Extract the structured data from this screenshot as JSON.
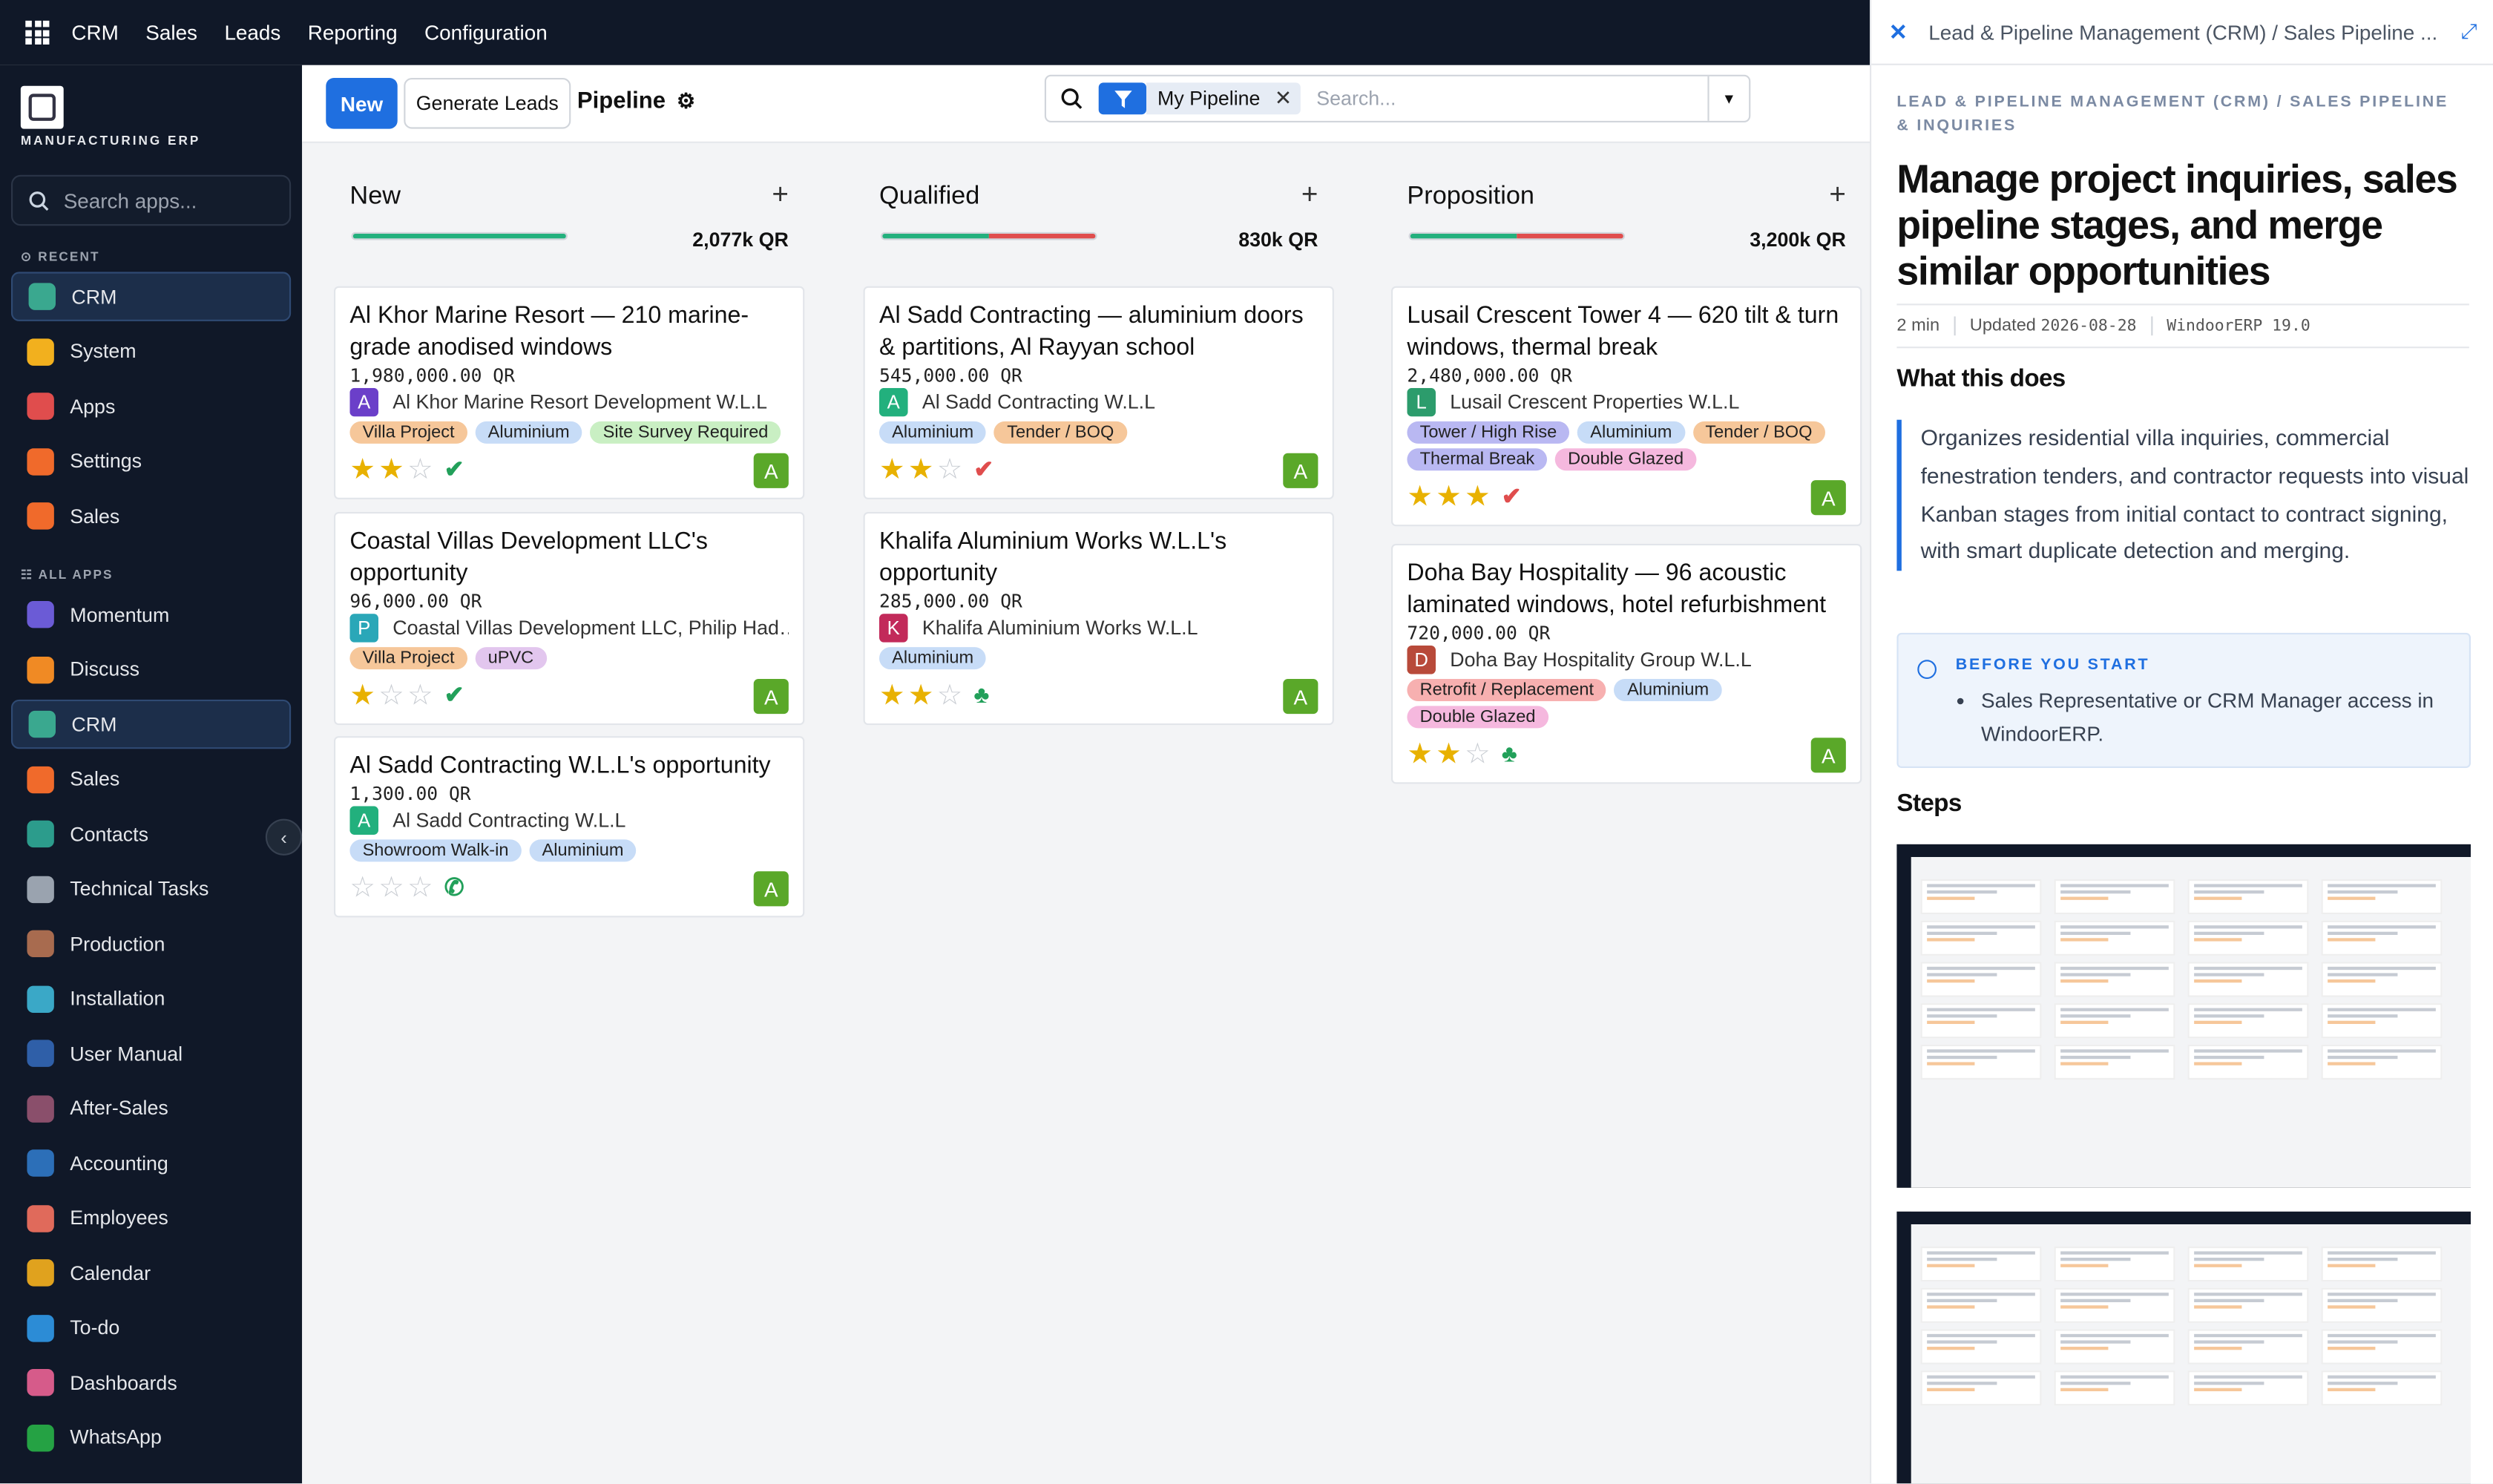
{
  "topbar": {
    "menus": [
      "CRM",
      "Sales",
      "Leads",
      "Reporting",
      "Configuration"
    ]
  },
  "sidebar": {
    "logo_text": "MANUFACTURING ERP",
    "search_placeholder": "Search apps...",
    "recent_label": "RECENT",
    "all_apps_label": "ALL APPS",
    "recent": [
      {
        "label": "CRM",
        "color": "#3aa88f"
      },
      {
        "label": "System",
        "color": "#f2b01e"
      },
      {
        "label": "Apps",
        "color": "#e04d4d"
      },
      {
        "label": "Settings",
        "color": "#f06a2b"
      },
      {
        "label": "Sales",
        "color": "#f06a2b"
      }
    ],
    "apps": [
      {
        "label": "Momentum",
        "color": "#6b5bd6"
      },
      {
        "label": "Discuss",
        "color": "#f08a24"
      },
      {
        "label": "CRM",
        "color": "#3aa88f"
      },
      {
        "label": "Sales",
        "color": "#f06a2b"
      },
      {
        "label": "Contacts",
        "color": "#2c9c8c"
      },
      {
        "label": "Technical Tasks",
        "color": "#9aa3af"
      },
      {
        "label": "Production",
        "color": "#a86b4f"
      },
      {
        "label": "Installation",
        "color": "#3aa8c7"
      },
      {
        "label": "User Manual",
        "color": "#2f5fa8"
      },
      {
        "label": "After-Sales",
        "color": "#8a4f6b"
      },
      {
        "label": "Accounting",
        "color": "#2c6fb8"
      },
      {
        "label": "Employees",
        "color": "#e06a5b"
      },
      {
        "label": "Calendar",
        "color": "#e0a21e"
      },
      {
        "label": "To-do",
        "color": "#2c8cd6"
      },
      {
        "label": "Dashboards",
        "color": "#d65b8a"
      },
      {
        "label": "WhatsApp",
        "color": "#25a244"
      }
    ]
  },
  "control": {
    "new_label": "New",
    "generate_label": "Generate Leads",
    "title": "Pipeline",
    "filter_chip": "My Pipeline",
    "search_placeholder": "Search..."
  },
  "columns": [
    {
      "name": "New",
      "amount": "2,077k QR",
      "progress": [
        {
          "color": "#22b07d",
          "value": 1.0
        }
      ],
      "cards": [
        {
          "title": "Al Khor Marine Resort — 210 marine-grade anodised windows",
          "amount": "1,980,000.00 QR",
          "avatar": "A",
          "avatar_color": "#6b3fc9",
          "company": "Al Khor Marine Resort Development W.L.L",
          "tags": [
            {
              "label": "Villa Project",
              "color": "#f6c79a"
            },
            {
              "label": "Aluminium",
              "color": "#c7dcf7"
            },
            {
              "label": "Site Survey Required",
              "color": "#c9efc3"
            }
          ],
          "stars": 2,
          "activity": "✔",
          "activity_color": "#22a05a",
          "user": "A"
        },
        {
          "title": "Coastal Villas Development LLC's opportunity",
          "amount": "96,000.00 QR",
          "avatar": "P",
          "avatar_color": "#2aa7b8",
          "company": "Coastal Villas Development LLC, Philip Had…",
          "tags": [
            {
              "label": "Villa Project",
              "color": "#f6c79a"
            },
            {
              "label": "uPVC",
              "color": "#e2c6ee"
            }
          ],
          "stars": 1,
          "activity": "✔",
          "activity_color": "#22a05a",
          "user": "A"
        },
        {
          "title": "Al Sadd Contracting W.L.L's opportunity",
          "amount": "1,300.00 QR",
          "avatar": "A",
          "avatar_color": "#22b07d",
          "company": "Al Sadd Contracting W.L.L",
          "tags": [
            {
              "label": "Showroom Walk-in",
              "color": "#c7dcf7"
            },
            {
              "label": "Aluminium",
              "color": "#c7dcf7"
            }
          ],
          "stars": 0,
          "activity": "✆",
          "activity_color": "#22a05a",
          "user": "A"
        }
      ]
    },
    {
      "name": "Qualified",
      "amount": "830k QR",
      "progress": [
        {
          "color": "#22b07d",
          "value": 0.5
        },
        {
          "color": "#e04d4d",
          "value": 0.5
        }
      ],
      "cards": [
        {
          "title": "Al Sadd Contracting — aluminium doors & partitions, Al Rayyan school",
          "amount": "545,000.00 QR",
          "avatar": "A",
          "avatar_color": "#22b07d",
          "company": "Al Sadd Contracting W.L.L",
          "tags": [
            {
              "label": "Aluminium",
              "color": "#c7dcf7"
            },
            {
              "label": "Tender / BOQ",
              "color": "#f6c79a"
            }
          ],
          "stars": 2,
          "activity": "✔",
          "activity_color": "#e04d4d",
          "user": "A"
        },
        {
          "title": "Khalifa Aluminium Works W.L.L's opportunity",
          "amount": "285,000.00 QR",
          "avatar": "K",
          "avatar_color": "#c22a5a",
          "company": "Khalifa Aluminium Works W.L.L",
          "tags": [
            {
              "label": "Aluminium",
              "color": "#c7dcf7"
            }
          ],
          "stars": 2,
          "activity": "♣",
          "activity_color": "#22a05a",
          "user": "A"
        }
      ]
    },
    {
      "name": "Proposition",
      "amount": "3,200k QR",
      "progress": [
        {
          "color": "#22b07d",
          "value": 0.5
        },
        {
          "color": "#e04d4d",
          "value": 0.5
        }
      ],
      "cards": [
        {
          "title": "Lusail Crescent Tower 4 — 620 tilt & turn windows, thermal break",
          "amount": "2,480,000.00 QR",
          "avatar": "L",
          "avatar_color": "#2c9c6c",
          "company": "Lusail Crescent Properties W.L.L",
          "tags": [
            {
              "label": "Tower / High Rise",
              "color": "#b9b8f2"
            },
            {
              "label": "Aluminium",
              "color": "#c7dcf7"
            },
            {
              "label": "Tender / BOQ",
              "color": "#f6c79a"
            },
            {
              "label": "Thermal Break",
              "color": "#b9b8f2"
            },
            {
              "label": "Double Glazed",
              "color": "#f5b8de"
            }
          ],
          "stars": 3,
          "activity": "✔",
          "activity_color": "#e04d4d",
          "user": "A"
        },
        {
          "title": "Doha Bay Hospitality — 96 acoustic laminated windows, hotel refurbishment",
          "amount": "720,000.00 QR",
          "avatar": "D",
          "avatar_color": "#b84a3a",
          "company": "Doha Bay Hospitality Group W.L.L",
          "tags": [
            {
              "label": "Retrofit / Replacement",
              "color": "#f7b0b0"
            },
            {
              "label": "Aluminium",
              "color": "#c7dcf7"
            },
            {
              "label": "Double Glazed",
              "color": "#f5b8de"
            }
          ],
          "stars": 2,
          "activity": "♣",
          "activity_color": "#22a05a",
          "user": "A"
        }
      ]
    }
  ],
  "panel": {
    "breadcrumb": "Lead & Pipeline Management (CRM) / Sales Pipeline ...",
    "category": "LEAD & PIPELINE MANAGEMENT (CRM) / SALES PIPELINE & INQUIRIES",
    "title": "Manage project inquiries, sales pipeline stages, and merge similar opportunities",
    "read_time": "2 min",
    "updated_label": "Updated",
    "updated_date": "2026-08-28",
    "version": "WindoorERP 19.0",
    "what_heading": "What this does",
    "what_text": "Organizes residential villa inquiries, commercial fenestration tenders, and contractor requests into visual Kanban stages from initial contact to contract signing, with smart duplicate detection and merging.",
    "before_label": "BEFORE YOU START",
    "before_item": "Sales Representative or CRM Manager access in WindoorERP.",
    "steps_heading": "Steps"
  }
}
